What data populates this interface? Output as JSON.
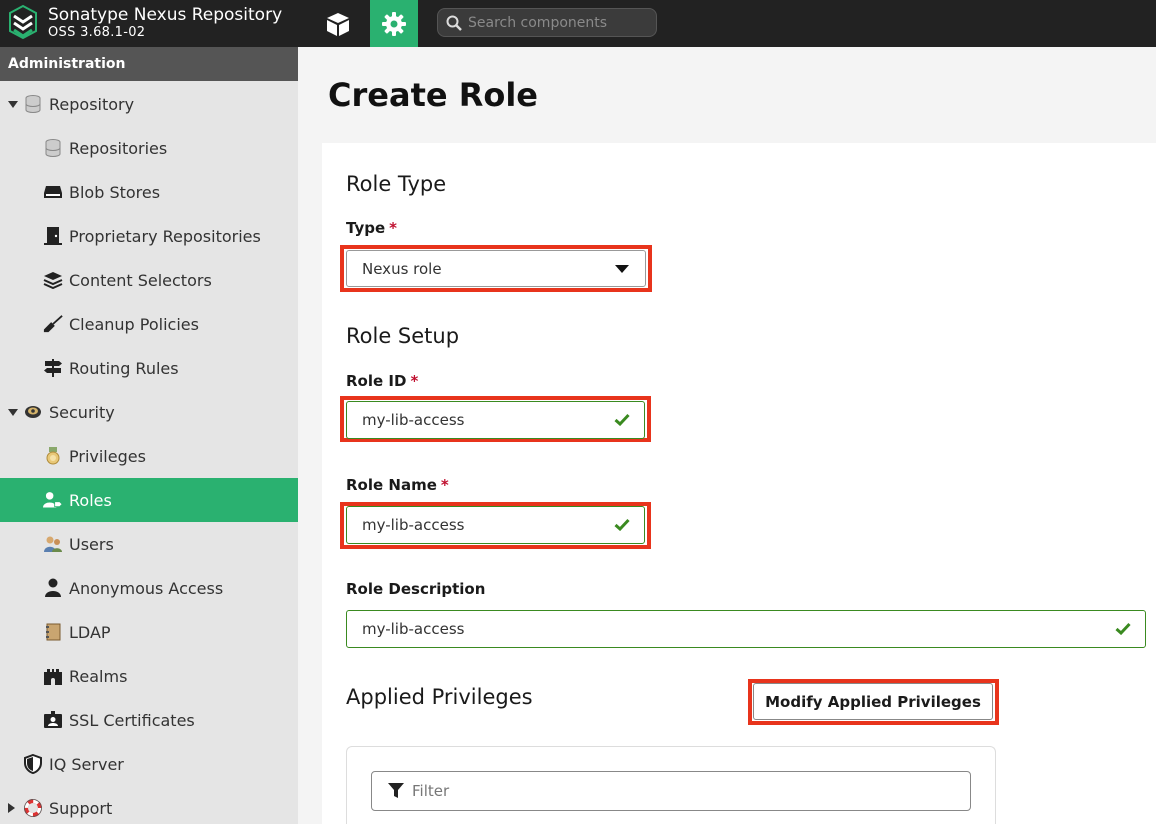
{
  "topbar": {
    "brand_title": "Sonatype Nexus Repository",
    "brand_version": "OSS 3.68.1-02",
    "search_placeholder": "Search components",
    "accent_color": "#2ab170"
  },
  "sidebar": {
    "header": "Administration",
    "items": [
      {
        "label": "Repository",
        "icon": "database-icon"
      },
      {
        "label": "Repositories",
        "icon": "database-icon"
      },
      {
        "label": "Blob Stores",
        "icon": "hard-drive-icon"
      },
      {
        "label": "Proprietary Repositories",
        "icon": "door-icon"
      },
      {
        "label": "Content Selectors",
        "icon": "layers-icon"
      },
      {
        "label": "Cleanup Policies",
        "icon": "broom-icon"
      },
      {
        "label": "Routing Rules",
        "icon": "signpost-icon"
      },
      {
        "label": "Security",
        "icon": "security-badge-icon"
      },
      {
        "label": "Privileges",
        "icon": "medal-icon"
      },
      {
        "label": "Roles",
        "icon": "user-tag-icon"
      },
      {
        "label": "Users",
        "icon": "users-icon"
      },
      {
        "label": "Anonymous Access",
        "icon": "user-icon"
      },
      {
        "label": "LDAP",
        "icon": "address-book-icon"
      },
      {
        "label": "Realms",
        "icon": "castle-icon"
      },
      {
        "label": "SSL Certificates",
        "icon": "id-badge-icon"
      },
      {
        "label": "IQ Server",
        "icon": "shield-icon"
      },
      {
        "label": "Support",
        "icon": "lifebuoy-icon"
      }
    ]
  },
  "main": {
    "title": "Create Role",
    "role_type_heading": "Role Type",
    "type_label": "Type",
    "required_mark": "*",
    "type_value": "Nexus role",
    "role_setup_heading": "Role Setup",
    "role_id_label": "Role ID",
    "role_id_value": "my-lib-access",
    "role_name_label": "Role Name",
    "role_name_value": "my-lib-access",
    "role_description_label": "Role Description",
    "role_description_value": "my-lib-access",
    "applied_privileges_heading": "Applied Privileges",
    "modify_button": "Modify Applied Privileges",
    "filter_placeholder": "Filter",
    "highlight_color": "#e8341c",
    "valid_color": "#3a8a20"
  }
}
